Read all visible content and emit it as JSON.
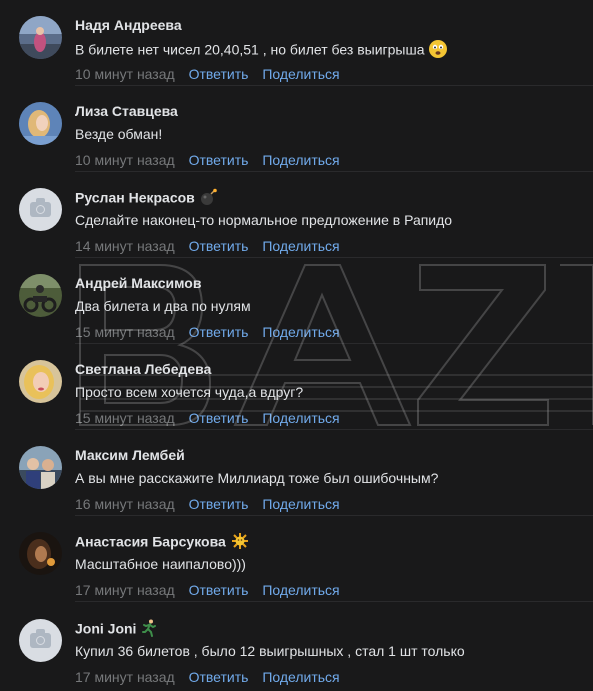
{
  "comments": [
    {
      "author": "Надя Андреева",
      "text": "В билете нет чисел 20,40,51 , но билет без выигрыша",
      "emoji": "worried-face-icon",
      "time": "10 минут назад",
      "reply_label": "Ответить",
      "share_label": "Поделиться",
      "avatar": "photo"
    },
    {
      "author": "Лиза Ставцева",
      "text": "Везде обман!",
      "time": "10 минут назад",
      "reply_label": "Ответить",
      "share_label": "Поделиться",
      "avatar": "photo"
    },
    {
      "author": "Руслан Некрасов",
      "author_emoji": "bomb-icon",
      "text": "Сделайте наконец-то нормальное предложение в Рапидо",
      "time": "14 минут назад",
      "reply_label": "Ответить",
      "share_label": "Поделиться",
      "avatar": "placeholder"
    },
    {
      "author": "Андрей Максимов",
      "text": "Два билета и два по нулям",
      "time": "15 минут назад",
      "reply_label": "Ответить",
      "share_label": "Поделиться",
      "avatar": "photo"
    },
    {
      "author": "Светлана Лебедева",
      "text": "Просто всем хочется чуда,а вдруг?",
      "time": "15 минут назад",
      "reply_label": "Ответить",
      "share_label": "Поделиться",
      "avatar": "photo"
    },
    {
      "author": "Максим Лембей",
      "text": "А вы мне расскажите Миллиард тоже был ошибочным?",
      "time": "16 минут назад",
      "reply_label": "Ответить",
      "share_label": "Поделиться",
      "avatar": "photo"
    },
    {
      "author": "Анастасия Барсукова",
      "author_emoji": "sun-icon",
      "text": "Масштабное наипалово)))",
      "time": "17 минут назад",
      "reply_label": "Ответить",
      "share_label": "Поделиться",
      "avatar": "photo"
    },
    {
      "author": "Joni Joni",
      "author_emoji": "runner-icon",
      "text": "Купил 36 билетов , было 12 выигрышных , стал 1 шт только",
      "time": "17 минут назад",
      "reply_label": "Ответить",
      "share_label": "Поделиться",
      "avatar": "placeholder"
    }
  ],
  "colors": {
    "background": "#19191a",
    "text": "#e1e3e6",
    "muted": "#76787a",
    "link": "#71aaeb"
  },
  "watermark": {
    "icon": "baza-logo-watermark",
    "text": "BAZA"
  }
}
